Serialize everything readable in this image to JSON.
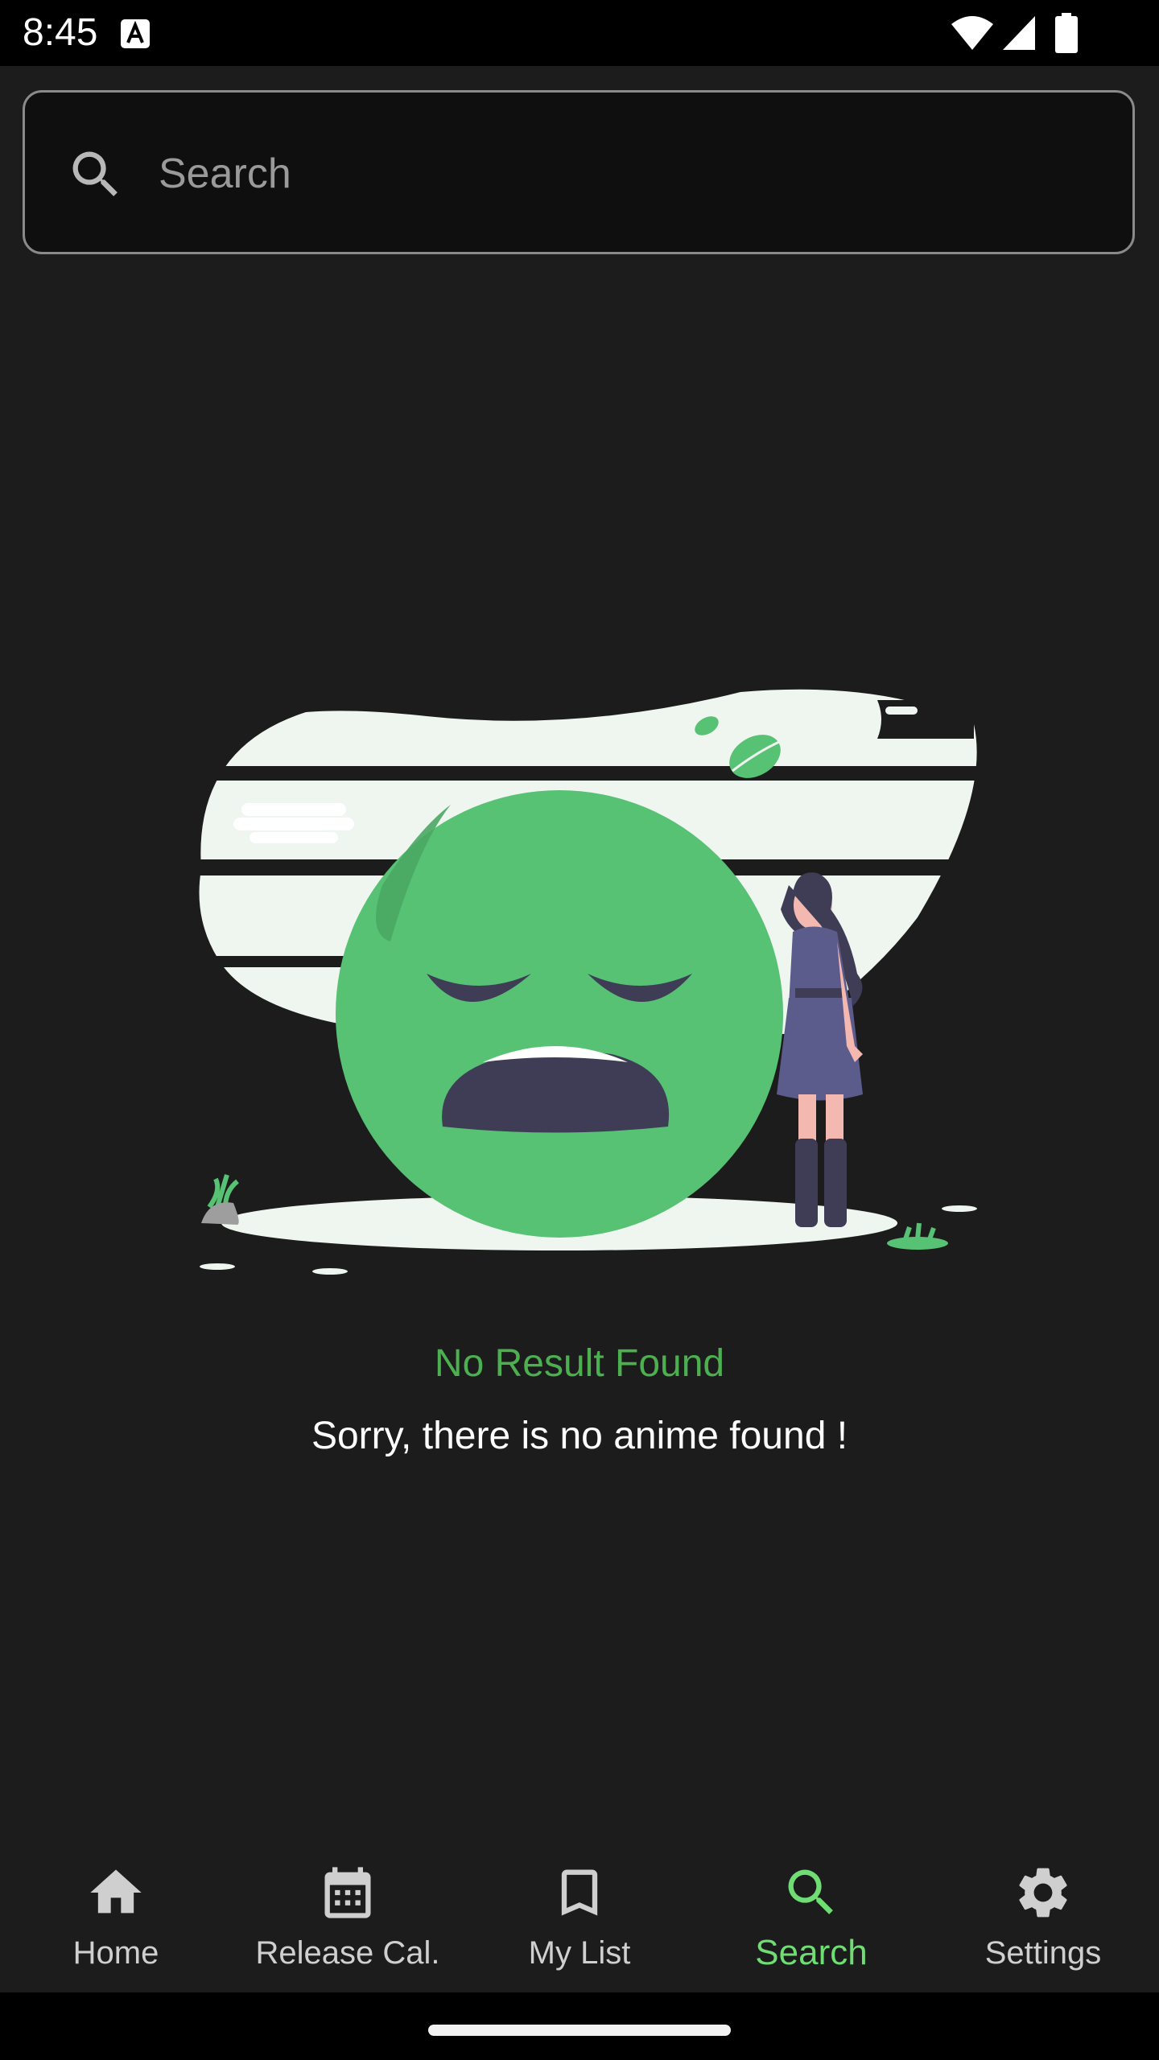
{
  "status_bar": {
    "time": "8:45"
  },
  "search": {
    "placeholder": "Search",
    "value": ""
  },
  "empty_state": {
    "title": "No Result Found",
    "message": "Sorry, there is no anime found !"
  },
  "bottom_nav": {
    "items": [
      {
        "label": "Home",
        "icon": "home-icon"
      },
      {
        "label": "Release Cal.",
        "icon": "calendar-icon"
      },
      {
        "label": "My List",
        "icon": "bookmark-icon"
      },
      {
        "label": "Search",
        "icon": "search-icon",
        "active": true
      },
      {
        "label": "Settings",
        "icon": "gear-icon"
      }
    ]
  },
  "colors": {
    "background": "#1c1c1c",
    "accent": "#4caf50",
    "active_nav": "#6fdc74",
    "emoji_face": "#57c174",
    "figure_dress": "#5b5b8c"
  }
}
